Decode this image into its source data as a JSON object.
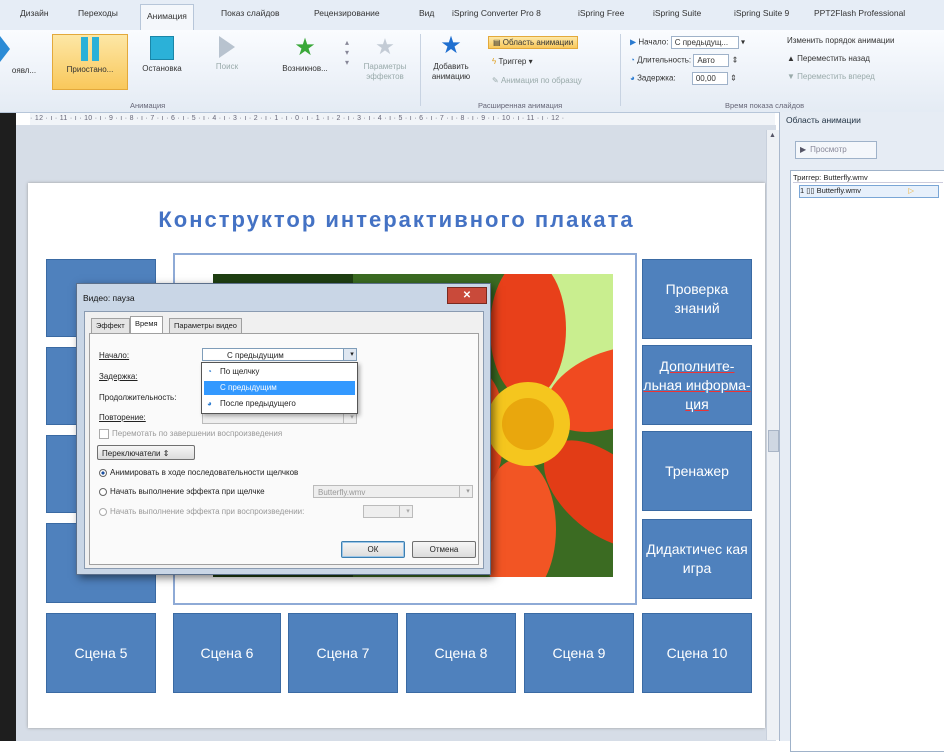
{
  "ribbon": {
    "tabs": [
      "Дизайн",
      "Переходы",
      "Анимация",
      "Показ слайдов",
      "Рецензирование",
      "Вид",
      "iSpring Converter Pro 8",
      "iSpring Free",
      "iSpring Suite",
      "iSpring Suite 9",
      "PPT2Flash Professional"
    ],
    "active_tab_index": 2,
    "anim_buttons": [
      "оявл...",
      "Приостано...",
      "Остановка",
      "Поиск",
      "Возникнов..."
    ],
    "effect_params": "Параметры эффектов",
    "group_animation": "Анимация",
    "add_animation": "Добавить анимацию",
    "anim_pane_btn": "Область анимации",
    "trigger": "Триггер",
    "anim_painter": "Анимация по образцу",
    "group_extended": "Расширенная анимация",
    "start_label": "Начало:",
    "start_value": "С предыдущ...",
    "duration_label": "Длительность:",
    "duration_value": "Авто",
    "delay_label": "Задержка:",
    "delay_value": "00,00",
    "reorder": "Изменить порядок анимации",
    "move_back": "Переместить назад",
    "move_forward": "Переместить вперед",
    "group_timing": "Время показа слайдов"
  },
  "ruler": "· 12 · ı · 11 · ı · 10 · ı · 9 · ı · 8 · ı · 7 · ı · 6 · ı · 5 · ı · 4 · ı · 3 · ı · 2 · ı · 1 · ı · 0 · ı · 1 · ı · 2 · ı · 3 · ı · 4 · ı · 5 · ı · 6 · ı · 7 · ı · 8 · ı · 9 · ı · 10 · ı · 11 · ı · 12 ·",
  "slide": {
    "title": "Конструктор интерактивного плаката",
    "right_tiles": [
      "Проверка знаний",
      "Дополните-льная информа-ция",
      "Тренажер",
      "Дидактичес кая игра"
    ],
    "bottom_tiles": [
      "Сцена 5",
      "Сцена 6",
      "Сцена 7",
      "Сцена 8",
      "Сцена 9",
      "Сцена 10"
    ]
  },
  "pane": {
    "title": "Область анимации",
    "preview": "Просмотр",
    "trigger_header": "Триггер: Butterfly.wmv",
    "item": "1 ▯▯ Butterfly.wmv"
  },
  "dialog": {
    "title": "Видео: пауза",
    "tabs": [
      "Эффект",
      "Время",
      "Параметры видео"
    ],
    "start_label": "Начало:",
    "start_value": "С предыдущим",
    "delay_label": "Задержка:",
    "duration_label": "Продолжительность:",
    "repeat_label": "Повторение:",
    "rewind_label": "Перемотать по завершении воспроизведения",
    "triggers_btn": "Переключатели ⇕",
    "radio1": "Анимировать в ходе последовательности щелчков",
    "radio2": "Начать выполнение эффекта при щелчке",
    "radio2_value": "Butterfly.wmv",
    "radio3": "Начать выполнение эффекта при воспроизведении:",
    "ok": "ОК",
    "cancel": "Отмена",
    "options": [
      "По щелчку",
      "С предыдущим",
      "После предыдущего"
    ],
    "selected_option_index": 1
  },
  "colors": {
    "tile": "#4f81bd",
    "title": "#4472c4",
    "selection": "#3399ff"
  }
}
